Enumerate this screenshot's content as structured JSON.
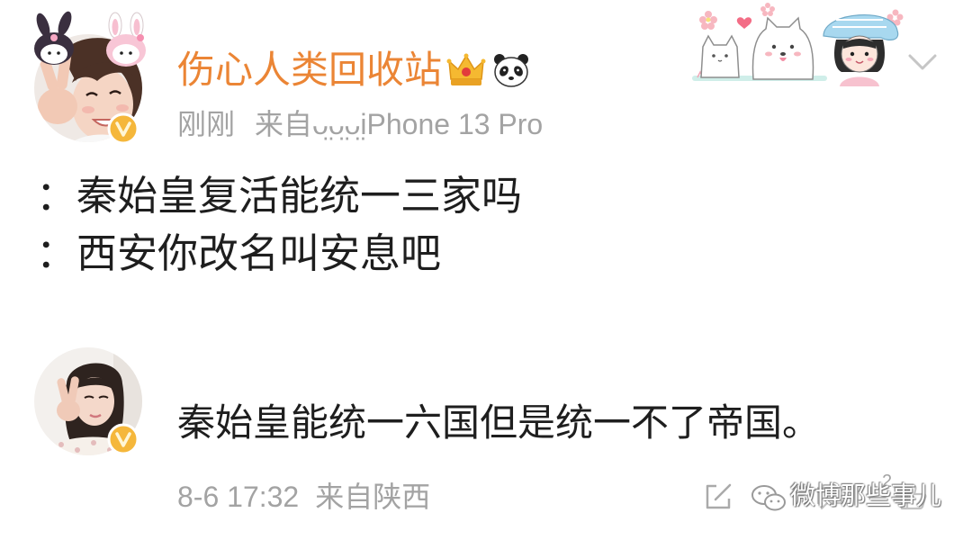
{
  "post": {
    "author": {
      "name": "伤心人类回收站",
      "avatar_icon": "user-avatar",
      "verified_icon": "verified-badge-icon",
      "name_badges": [
        "crown-emoji-icon",
        "panda-emoji-icon"
      ]
    },
    "time": "刚刚",
    "source": "来自ᴗ̤ᴗ̤ᴗ̤iPhone 13 Pro",
    "lines": [
      {
        "prefix": "：",
        "text": "秦始皇复活能统一三家吗"
      },
      {
        "prefix": "：",
        "text": "西安你改名叫安息吧"
      }
    ],
    "header_decoration_icon": "cartoon-stickers",
    "menu_icon": "chevron-down-icon"
  },
  "comment": {
    "avatar_icon": "user-avatar",
    "verified_icon": "verified-badge-icon",
    "text": "秦始皇能统一六国但是统一不了帝国。",
    "time": "8-6 17:32",
    "location": "来自陕西",
    "actions": {
      "share_icon": "share-icon",
      "comment_icon": "comment-icon",
      "like_icon": "like-icon",
      "like_count": "2"
    }
  },
  "watermark": {
    "icon": "wechat-icon",
    "text": "微博那些事儿"
  },
  "colors": {
    "username": "#eb8535",
    "meta_text": "#a3a3a3",
    "body_text": "#1e1e1e",
    "verified_badge": "#f5b73b",
    "icon_gray": "#b3b3b3",
    "background": "#ffffff"
  }
}
